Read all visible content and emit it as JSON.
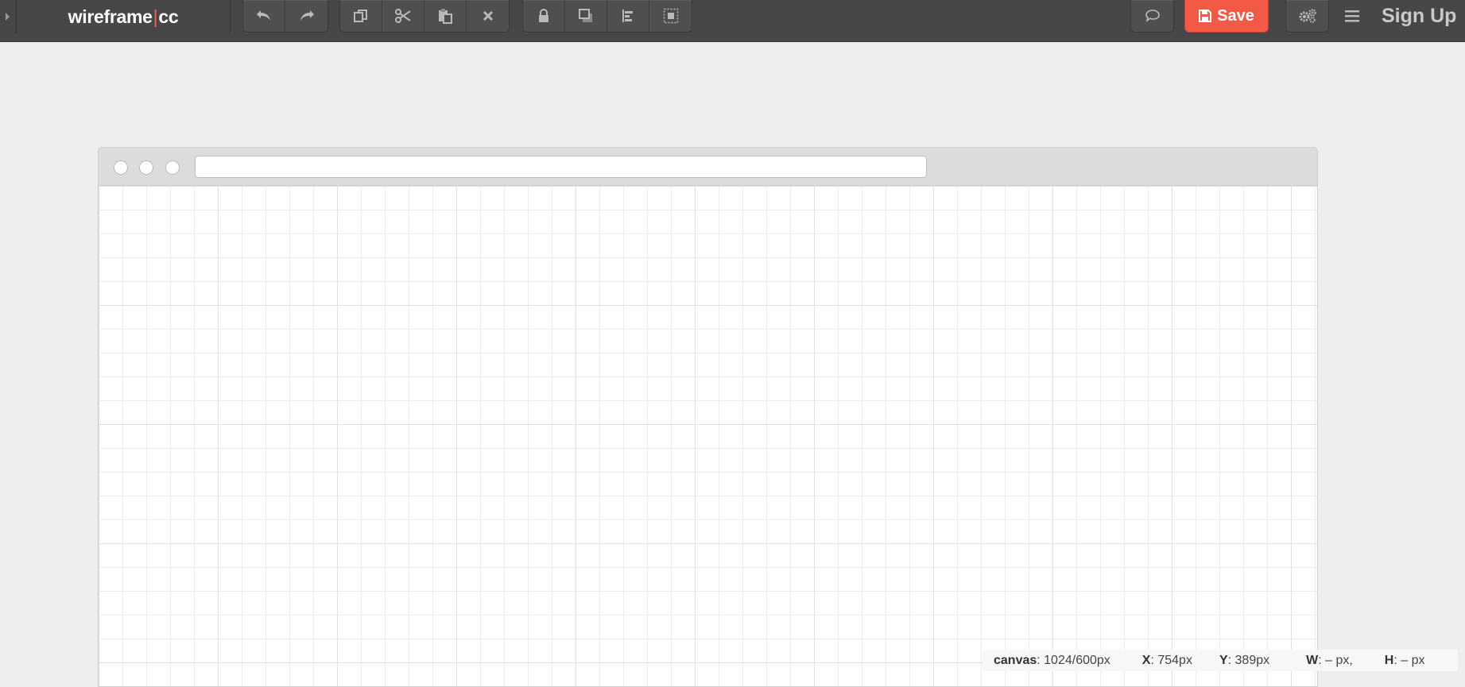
{
  "app": {
    "brand_left": "wireframe",
    "brand_sep": "|",
    "brand_right": "cc"
  },
  "toolbar": {
    "groups": [
      [
        "undo-icon",
        "redo-icon"
      ],
      [
        "copy-icon",
        "cut-icon",
        "paste-icon",
        "delete-icon"
      ],
      [
        "lock-icon",
        "layer-order-icon",
        "align-icon",
        "group-select-icon"
      ]
    ],
    "comment_icon": "speech-bubble-icon",
    "save_label": "Save",
    "save_icon": "floppy-disk-icon",
    "settings_icon": "gears-icon",
    "menu_icon": "hamburger-menu-icon",
    "signup_label": "Sign Up"
  },
  "colors": {
    "topbar": "#474747",
    "accent": "#f35a45",
    "canvas_bg": "#eeeeee"
  },
  "status": {
    "canvas_key": "canvas",
    "canvas_value": ": 1024/600px",
    "x_key": "X",
    "x_value": ": 754px",
    "y_key": "Y",
    "y_value": ": 389px",
    "w_key": "W",
    "w_value": ": – px,",
    "h_key": "H",
    "h_value": ": – px"
  }
}
